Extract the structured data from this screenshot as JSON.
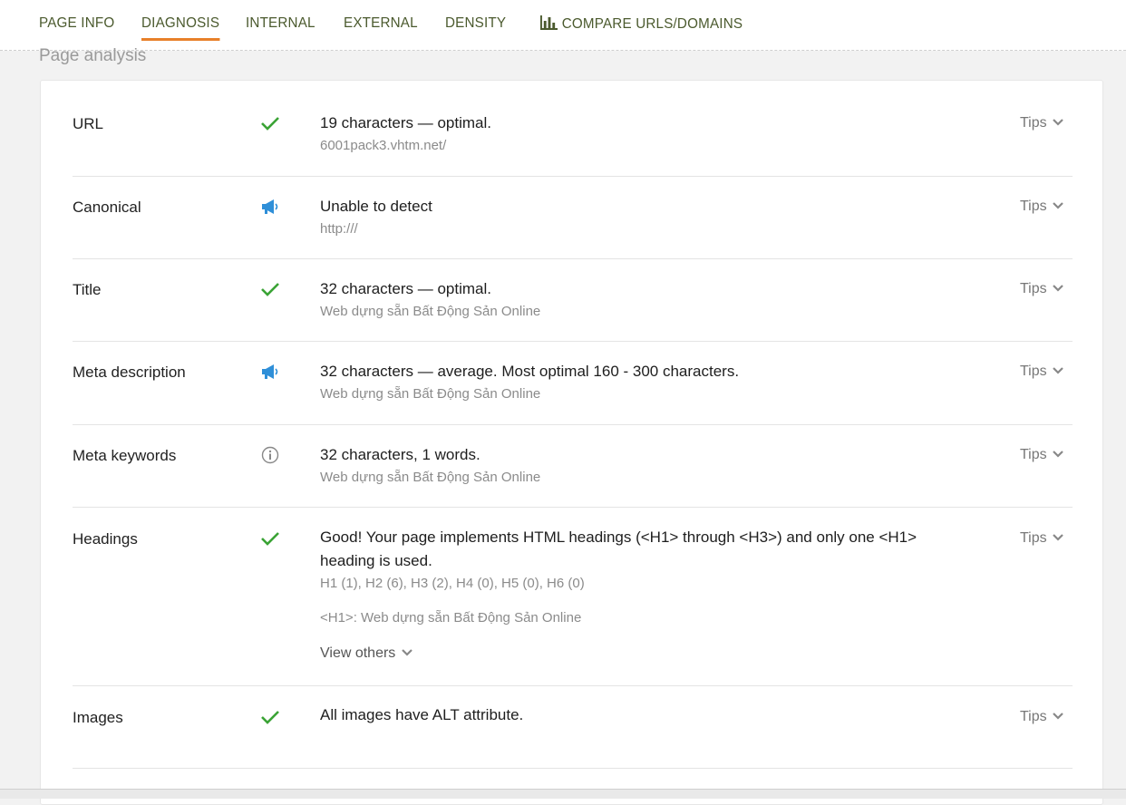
{
  "nav": {
    "tabs": [
      {
        "label": "PAGE INFO"
      },
      {
        "label": "DIAGNOSIS"
      },
      {
        "label": "INTERNAL"
      },
      {
        "label": "EXTERNAL"
      },
      {
        "label": "DENSITY"
      },
      {
        "label": "COMPARE URLS/DOMAINS",
        "icon": "bar-chart-icon"
      }
    ],
    "active_tab": "DIAGNOSIS",
    "accent_color": "#e8802a",
    "tab_color": "#4b5a2e"
  },
  "section": {
    "title": "Page analysis"
  },
  "tips_label": "Tips",
  "rows": [
    {
      "label": "URL",
      "status": "check",
      "main": "19 characters — optimal.",
      "sub": "6001pack3.vhtm.net/"
    },
    {
      "label": "Canonical",
      "status": "megaphone",
      "main": "Unable to detect",
      "sub": "http:///"
    },
    {
      "label": "Title",
      "status": "check",
      "main": "32 characters — optimal.",
      "sub": "Web dựng sẵn Bất Động Sản Online"
    },
    {
      "label": "Meta description",
      "status": "megaphone",
      "main": "32 characters — average. Most optimal 160 - 300 characters.",
      "sub": "Web dựng sẵn Bất Động Sản Online"
    },
    {
      "label": "Meta keywords",
      "status": "info",
      "main": "32 characters, 1 words.",
      "sub": "Web dựng sẵn Bất Động Sản Online"
    },
    {
      "label": "Headings",
      "status": "check",
      "main": "Good! Your page implements HTML headings (<H1> through <H3>) and only one <H1> heading is used.",
      "sub": "H1 (1), H2 (6), H3 (2), H4 (0), H5 (0), H6 (0)",
      "sub2": "<H1>: Web dựng sẵn Bất Động Sản Online",
      "more": "View others"
    },
    {
      "label": "Images",
      "status": "check",
      "main": "All images have ALT attribute."
    }
  ],
  "status_colors": {
    "check": "#3aa335",
    "megaphone": "#2f8fd8",
    "info": "#888888"
  }
}
